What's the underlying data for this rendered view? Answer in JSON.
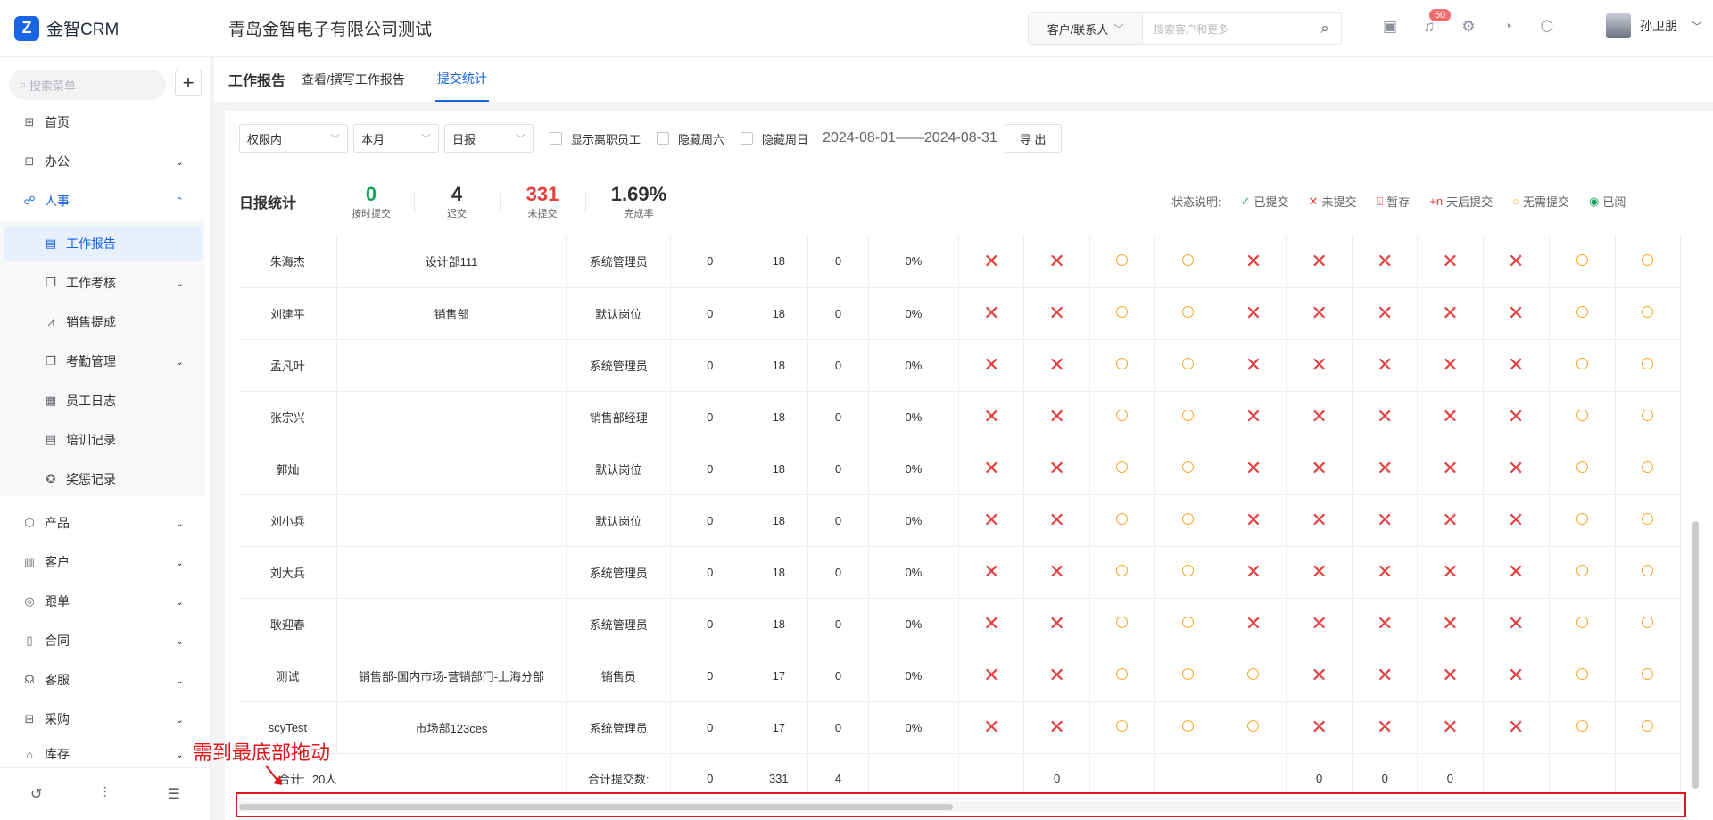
{
  "app": {
    "logo_text": "金智CRM",
    "company": "青岛金智电子有限公司测试"
  },
  "search": {
    "scope": "客户/联系人",
    "placeholder": "搜索客户和更多"
  },
  "header": {
    "notification_count": "50",
    "user_name": "孙卫朋"
  },
  "sidebar": {
    "search_placeholder": "搜索菜单",
    "items": [
      {
        "label": "首页",
        "icon": "home-icon"
      },
      {
        "label": "办公",
        "icon": "office-icon"
      },
      {
        "label": "人事",
        "icon": "hr-icon"
      },
      {
        "label": "工作报告",
        "icon": "report-icon"
      },
      {
        "label": "工作考核",
        "icon": "assessment-icon"
      },
      {
        "label": "销售提成",
        "icon": "commission-icon"
      },
      {
        "label": "考勤管理",
        "icon": "attendance-icon"
      },
      {
        "label": "员工日志",
        "icon": "log-icon"
      },
      {
        "label": "培训记录",
        "icon": "training-icon"
      },
      {
        "label": "奖惩记录",
        "icon": "award-icon"
      },
      {
        "label": "产品",
        "icon": "product-icon"
      },
      {
        "label": "客户",
        "icon": "customer-icon"
      },
      {
        "label": "跟单",
        "icon": "followup-icon"
      },
      {
        "label": "合同",
        "icon": "contract-icon"
      },
      {
        "label": "客服",
        "icon": "service-icon"
      },
      {
        "label": "采购",
        "icon": "purchase-icon"
      },
      {
        "label": "库存",
        "icon": "inventory-icon"
      }
    ]
  },
  "page": {
    "title": "工作报告",
    "tabs": [
      "查看/撰写工作报告",
      "提交统计"
    ]
  },
  "filters": {
    "scope": "权限内",
    "period": "本月",
    "type": "日报",
    "show_left": "显示离职员工",
    "hide_sat": "隐藏周六",
    "hide_sun": "隐藏周日",
    "date_range": "2024-08-01——2024-08-31",
    "export": "导 出"
  },
  "stats": {
    "title": "日报统计",
    "on_time": {
      "value": "0",
      "label": "按时提交"
    },
    "late": {
      "value": "4",
      "label": "迟交"
    },
    "missing": {
      "value": "331",
      "label": "未提交"
    },
    "rate": {
      "value": "1.69%",
      "label": "完成率"
    }
  },
  "legend": {
    "title": "状态说明:",
    "items": [
      {
        "label": "已提交",
        "icon": "check-icon",
        "color": "#19a35b"
      },
      {
        "label": "未提交",
        "icon": "cross-icon",
        "color": "#e54040"
      },
      {
        "label": "暂存",
        "icon": "draft-icon",
        "color": "#e54040"
      },
      {
        "label": "天后提交",
        "prefix": "+n",
        "color": "#e54040"
      },
      {
        "label": "无需提交",
        "icon": "circle-icon",
        "color": "#f5a623"
      },
      {
        "label": "已阅",
        "icon": "eye-icon",
        "color": "#19a35b"
      }
    ]
  },
  "table": {
    "rows": [
      {
        "name": "朱海杰",
        "dept": "设计部111",
        "role": "系统管理员",
        "on_time": "0",
        "missing": "18",
        "late": "0",
        "rate": "0%",
        "days": [
          "x",
          "x",
          "o",
          "o",
          "x",
          "x",
          "x",
          "x",
          "x",
          "o",
          "o"
        ]
      },
      {
        "name": "刘建平",
        "dept": "销售部",
        "role": "默认岗位",
        "on_time": "0",
        "missing": "18",
        "late": "0",
        "rate": "0%",
        "days": [
          "x",
          "x",
          "o",
          "o",
          "x",
          "x",
          "x",
          "x",
          "x",
          "o",
          "o"
        ]
      },
      {
        "name": "孟凡叶",
        "dept": "",
        "role": "系统管理员",
        "on_time": "0",
        "missing": "18",
        "late": "0",
        "rate": "0%",
        "days": [
          "x",
          "x",
          "o",
          "o",
          "x",
          "x",
          "x",
          "x",
          "x",
          "o",
          "o"
        ]
      },
      {
        "name": "张宗兴",
        "dept": "",
        "role": "销售部经理",
        "on_time": "0",
        "missing": "18",
        "late": "0",
        "rate": "0%",
        "days": [
          "x",
          "x",
          "o",
          "o",
          "x",
          "x",
          "x",
          "x",
          "x",
          "o",
          "o"
        ]
      },
      {
        "name": "郭灿",
        "dept": "",
        "role": "默认岗位",
        "on_time": "0",
        "missing": "18",
        "late": "0",
        "rate": "0%",
        "days": [
          "x",
          "x",
          "o",
          "o",
          "x",
          "x",
          "x",
          "x",
          "x",
          "o",
          "o"
        ]
      },
      {
        "name": "刘小兵",
        "dept": "",
        "role": "默认岗位",
        "on_time": "0",
        "missing": "18",
        "late": "0",
        "rate": "0%",
        "days": [
          "x",
          "x",
          "o",
          "o",
          "x",
          "x",
          "x",
          "x",
          "x",
          "o",
          "o"
        ]
      },
      {
        "name": "刘大兵",
        "dept": "",
        "role": "系统管理员",
        "on_time": "0",
        "missing": "18",
        "late": "0",
        "rate": "0%",
        "days": [
          "x",
          "x",
          "o",
          "o",
          "x",
          "x",
          "x",
          "x",
          "x",
          "o",
          "o"
        ]
      },
      {
        "name": "耿迎春",
        "dept": "",
        "role": "系统管理员",
        "on_time": "0",
        "missing": "18",
        "late": "0",
        "rate": "0%",
        "days": [
          "x",
          "x",
          "o",
          "o",
          "x",
          "x",
          "x",
          "x",
          "x",
          "o",
          "o"
        ]
      },
      {
        "name": "测试",
        "dept": "销售部-国内市场-营销部门-上海分部",
        "role": "销售员",
        "on_time": "0",
        "missing": "17",
        "late": "0",
        "rate": "0%",
        "days": [
          "x",
          "x",
          "o",
          "o",
          "o",
          "x",
          "x",
          "x",
          "x",
          "o",
          "o"
        ]
      },
      {
        "name": "scyTest",
        "dept": "市场部123ces",
        "role": "系统管理员",
        "on_time": "0",
        "missing": "17",
        "late": "0",
        "rate": "0%",
        "days": [
          "x",
          "x",
          "o",
          "o",
          "o",
          "x",
          "x",
          "x",
          "x",
          "o",
          "o"
        ]
      }
    ],
    "total": {
      "label": "合计:",
      "count": "20人",
      "submit_label": "合计提交数:",
      "on_time": "0",
      "missing": "331",
      "late": "4",
      "days": [
        "",
        "0",
        "",
        "",
        "",
        "0",
        "0",
        "0",
        "",
        "",
        ""
      ]
    }
  },
  "annotation": {
    "note": "需到最底部拖动"
  }
}
